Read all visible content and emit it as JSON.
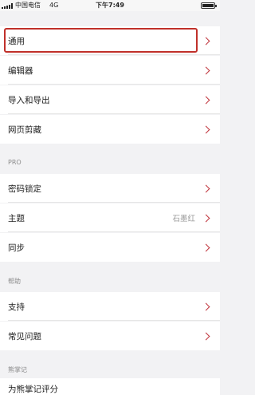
{
  "status_bar": {
    "carrier": "中国电信",
    "network": "4G",
    "time": "下午7:49"
  },
  "settings": {
    "group_general": [
      {
        "label": "通用"
      },
      {
        "label": "编辑器"
      },
      {
        "label": "导入和导出"
      },
      {
        "label": "网页剪藏"
      }
    ],
    "pro_header": "PRO",
    "group_pro": [
      {
        "label": "密码锁定"
      },
      {
        "label": "主题",
        "value": "石墨红"
      },
      {
        "label": "同步"
      }
    ],
    "help_header": "帮助",
    "group_help": [
      {
        "label": "支持"
      },
      {
        "label": "常见问题"
      }
    ],
    "bear_header": "熊掌记",
    "group_bear": [
      {
        "label": "为熊掌记评分"
      }
    ]
  },
  "colors": {
    "accent": "#c0343c",
    "highlight_box": "#c0302a"
  }
}
